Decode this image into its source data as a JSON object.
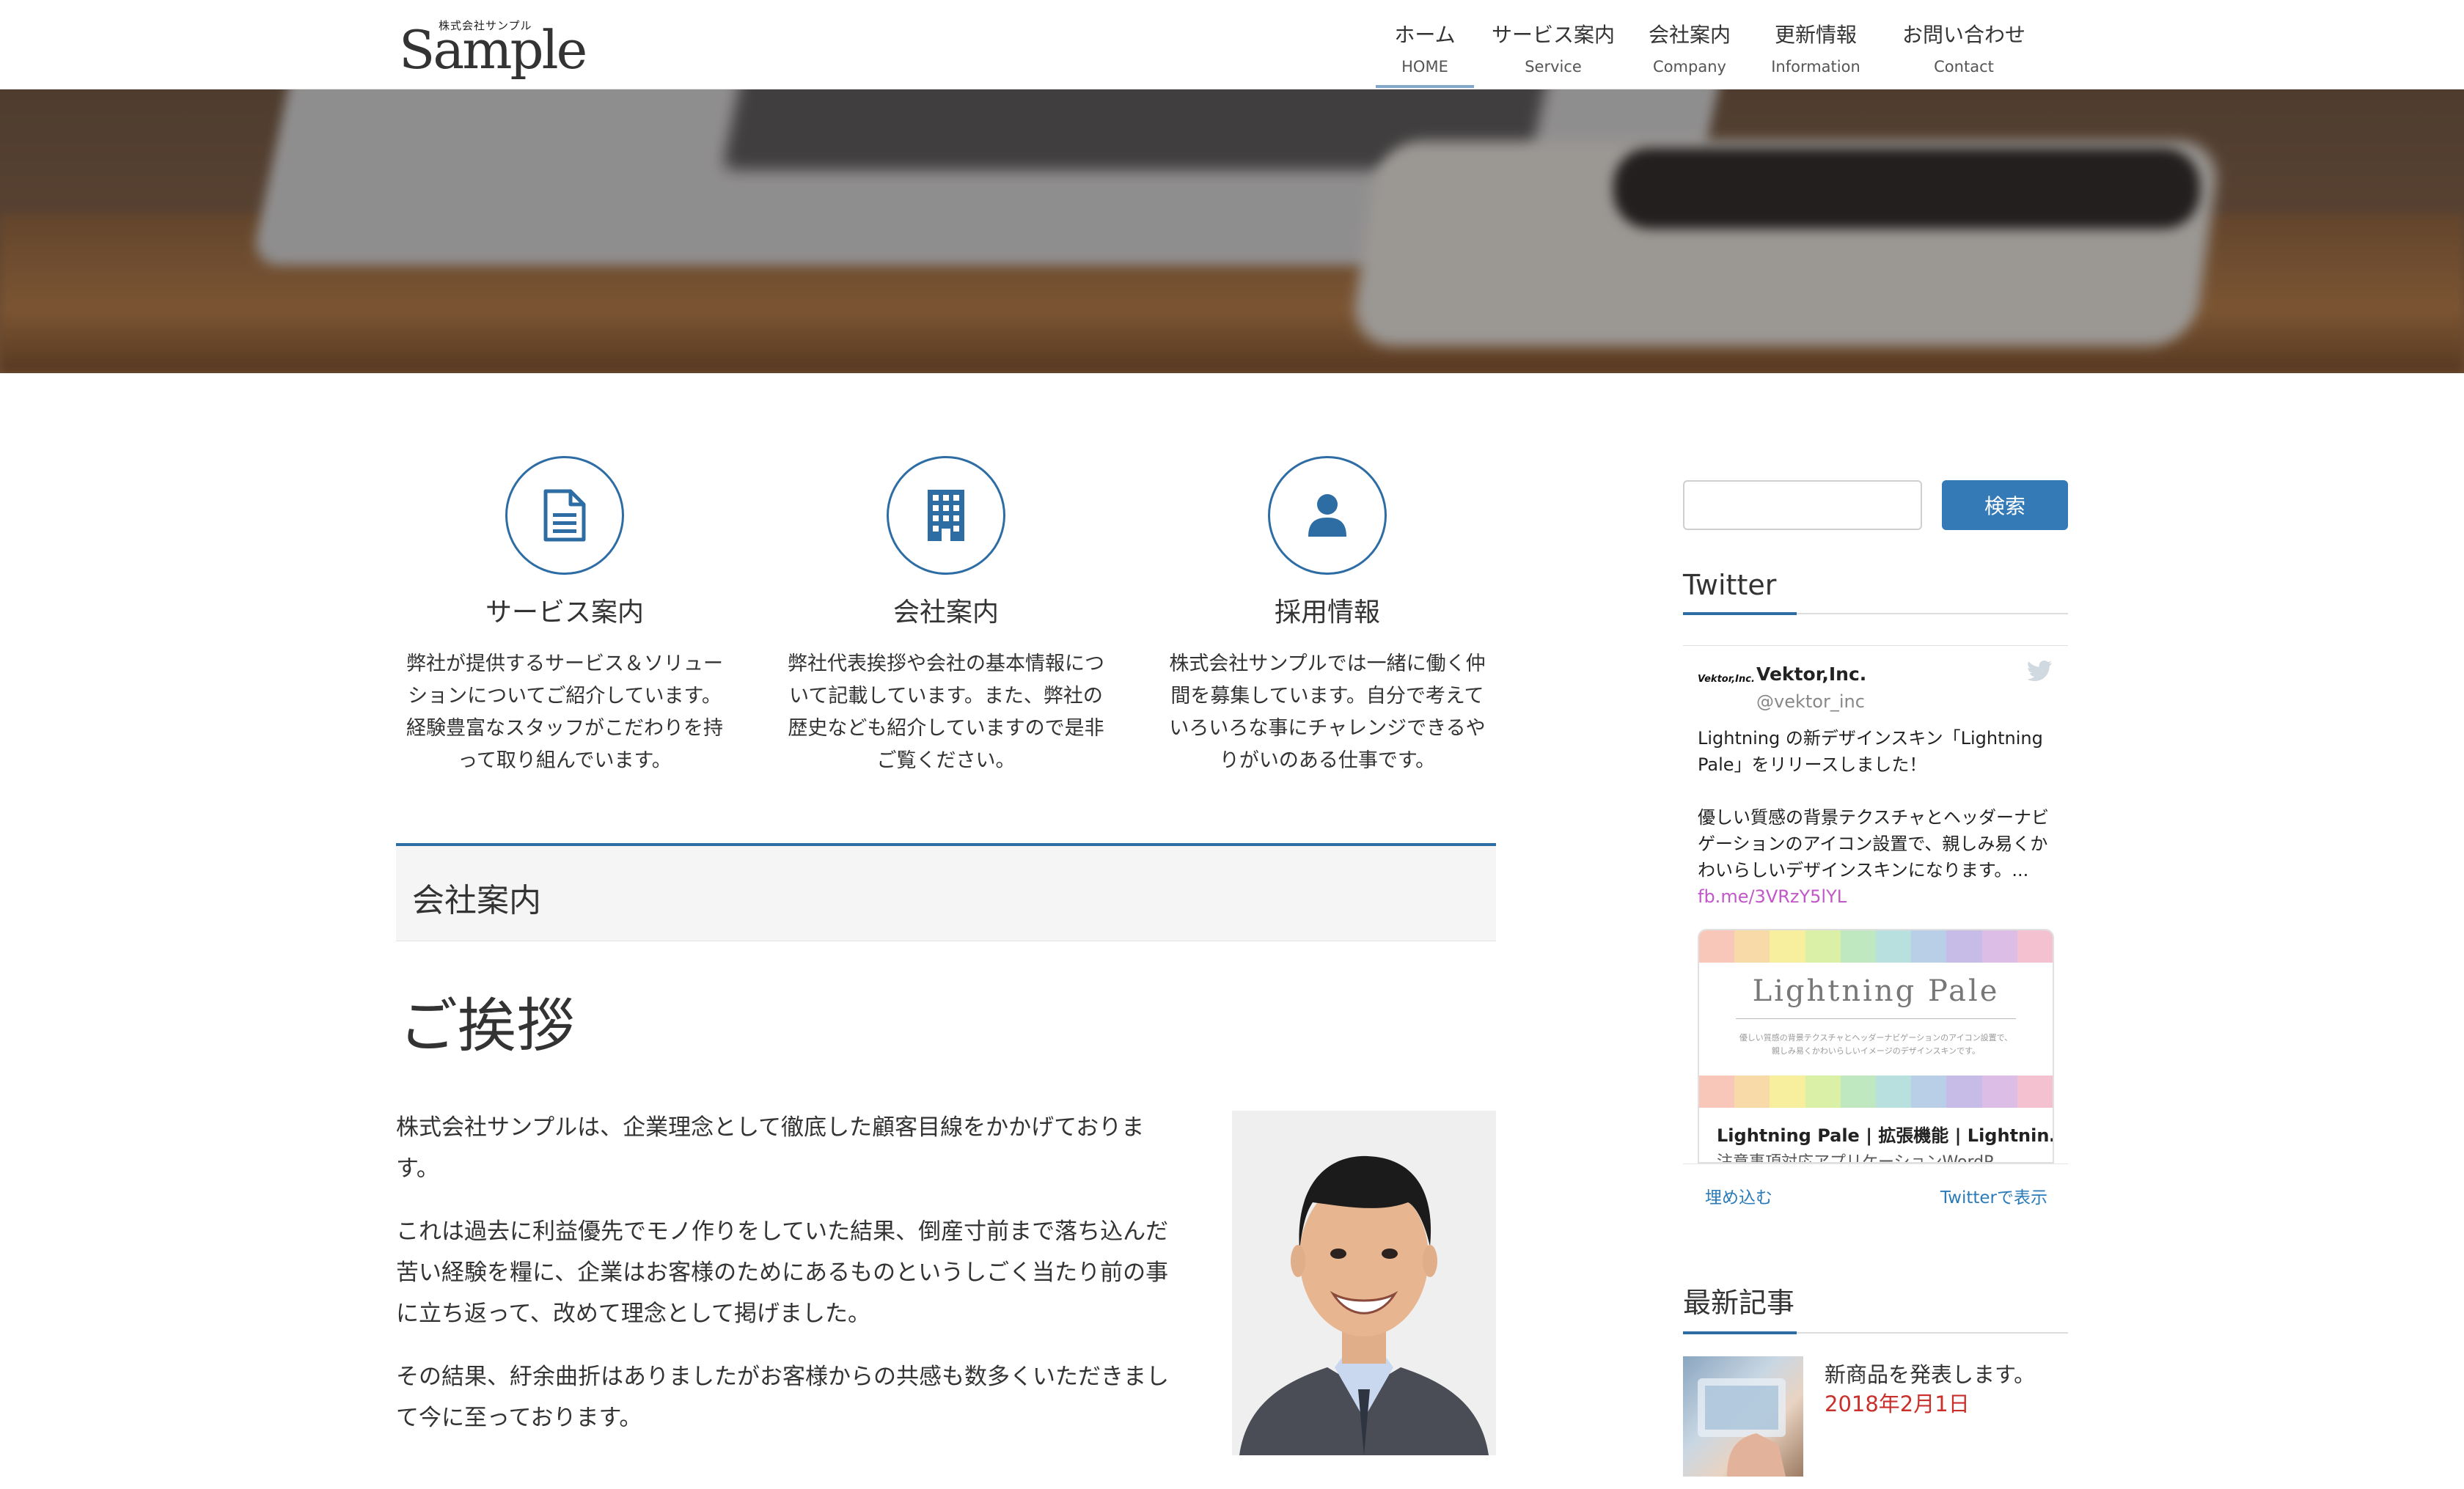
{
  "header": {
    "logo_small": "株式会社サンプル",
    "logo": "Sample",
    "nav": [
      {
        "jp": "ホーム",
        "en": "HOME"
      },
      {
        "jp": "サービス案内",
        "en": "Service"
      },
      {
        "jp": "会社案内",
        "en": "Company"
      },
      {
        "jp": "更新情報",
        "en": "Information"
      },
      {
        "jp": "お問い合わせ",
        "en": "Contact"
      }
    ]
  },
  "features": [
    {
      "icon": "document-icon",
      "title": "サービス案内",
      "lines": [
        "弊社が提供するサービス＆ソリュー",
        "ションについてご紹介しています。",
        "経験豊富なスタッフがこだわりを持",
        "って取り組んでいます。"
      ]
    },
    {
      "icon": "building-icon",
      "title": "会社案内",
      "lines": [
        "弊社代表挨拶や会社の基本情報につ",
        "いて記載しています。また、弊社の",
        "歴史なども紹介していますので是非",
        "ご覧ください。"
      ]
    },
    {
      "icon": "user-icon",
      "title": "採用情報",
      "lines": [
        "株式会社サンプルでは一緒に働く仲",
        "間を募集しています。自分で考えて",
        "いろいろな事にチャレンジできるや",
        "りがいのある仕事です。"
      ]
    }
  ],
  "section_title": "会社案内",
  "greeting": "ご挨拶",
  "paragraphs": [
    [
      "株式会社サンプルは、企業理念として徹底した顧客目線をかかげておりま",
      "す。"
    ],
    [
      "これは過去に利益優先でモノ作りをしていた結果、倒産寸前まで落ち込んだ",
      "苦い経験を糧に、企業はお客様のためにあるものというしごく当たり前の事",
      "に立ち返って、改めて理念として掲げました。"
    ],
    [
      "その結果、紆余曲折はありましたがお客様からの共感も数多くいただきまし",
      "て今に至っております。"
    ]
  ],
  "sidebar": {
    "search_button": "検索",
    "twitter_title": "Twitter",
    "tweet": {
      "name": "Vektor,Inc.",
      "handle": "@vektor_inc",
      "avatar_text": "Vektor,Inc.",
      "line1": "Lightning の新デザインスキン「Lightning",
      "line2": "Pale」をリリースしました！",
      "line3": "優しい質感の背景テクスチャとヘッダーナビ",
      "line4": "ゲーションのアイコン設置で、親しみ易くか",
      "line5": "わいらしいデザインスキンになります。...",
      "link": "fb.me/3VRzY5lYL",
      "card_title": "Lightning Pale",
      "card_sub1": "優しい質感の背景テクスチャとヘッダーナビゲーションのアイコン設置で、",
      "card_sub2": "親しみ易くかわいらしいイメージのデザインスキンです。",
      "card_caption": "Lightning Pale | 拡張機能 | Lightnin…",
      "card_caption2": "注意事項対応アプリケーションWordP"
    },
    "embed": "埋め込む",
    "view_on_twitter": "Twitterで表示",
    "recent_title": "最新記事",
    "post": {
      "title": "新商品を発表します。",
      "date": "2018年2月1日"
    }
  },
  "colors": {
    "accent": "#2e6da4",
    "button": "#337ab7",
    "date": "#c9302c",
    "link": "#2b7bb9"
  },
  "stripe_colors": [
    "#f9c7b9",
    "#f8d9a8",
    "#f7ef9e",
    "#d9f0a6",
    "#bfe8c0",
    "#b7e0df",
    "#b9cfe8",
    "#c7bce8",
    "#dbbde5",
    "#f3c1cf"
  ]
}
